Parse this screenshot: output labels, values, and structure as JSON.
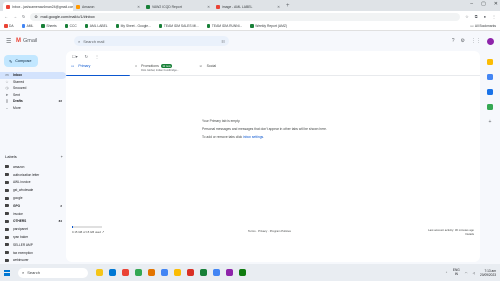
{
  "browser": {
    "tabs": [
      {
        "title": "Inbox - jashcameraw4man24@gmail.com",
        "color": "#ea4335",
        "active": true
      },
      {
        "title": "Amazon",
        "color": "#ff9900",
        "active": false
      },
      {
        "title": "VAW2 ICQD Report",
        "color": "#188038",
        "active": false
      },
      {
        "title": "image - AML LABEL",
        "color": "#ea4335",
        "active": false
      }
    ],
    "url": "mail.google.com/mail/u/1/#inbox",
    "bookmarks": [
      {
        "label": "DA",
        "color": "#ea4335"
      },
      {
        "label": "AML",
        "color": "#4285f4"
      },
      {
        "label": "Sheets",
        "color": "#188038"
      },
      {
        "label": "CCC",
        "color": "#188038"
      },
      {
        "label": "AML LABEL",
        "color": "#188038"
      },
      {
        "label": "My Sheet - Google...",
        "color": "#188038"
      },
      {
        "label": "TEAM IDM SALES MI...",
        "color": "#188038"
      },
      {
        "label": "TEAM IDM-RUNNI...",
        "color": "#188038"
      },
      {
        "label": "Weekly Report (AMZ)",
        "color": "#188038"
      }
    ],
    "all_bookmarks": "All Bookmarks"
  },
  "gmail": {
    "brand": "Gmail",
    "search_placeholder": "Search mail",
    "compose": "Compose",
    "nav": [
      {
        "label": "Inbox",
        "icon": "inbox-icon",
        "glyph": "▭",
        "count": "",
        "active": true
      },
      {
        "label": "Starred",
        "icon": "star-icon",
        "glyph": "☆",
        "count": ""
      },
      {
        "label": "Snoozed",
        "icon": "clock-icon",
        "glyph": "◷",
        "count": ""
      },
      {
        "label": "Sent",
        "icon": "send-icon",
        "glyph": "➤",
        "count": ""
      },
      {
        "label": "Drafts",
        "icon": "draft-icon",
        "glyph": "▯",
        "count": "22",
        "bold": true
      },
      {
        "label": "More",
        "icon": "chevron-down-icon",
        "glyph": "⌄",
        "count": ""
      }
    ],
    "labels_title": "Labels",
    "labels": [
      {
        "label": "amazon",
        "count": ""
      },
      {
        "label": "authorization letter",
        "count": ""
      },
      {
        "label": "AWL invoice",
        "count": ""
      },
      {
        "label": "gst_wholesale",
        "count": ""
      },
      {
        "label": "google",
        "count": ""
      },
      {
        "label": "GPO",
        "count": "2",
        "bold": true
      },
      {
        "label": "invoice",
        "count": ""
      },
      {
        "label": "OTHERS",
        "count": "84",
        "bold": true
      },
      {
        "label": "parcipanet",
        "count": ""
      },
      {
        "label": "ryan baker",
        "count": ""
      },
      {
        "label": "SELLER AMP",
        "count": ""
      },
      {
        "label": "tax exemption",
        "count": ""
      },
      {
        "label": "webinsurer",
        "count": ""
      },
      {
        "label": "WESTERN",
        "count": ""
      }
    ],
    "category_tabs": [
      {
        "label": "Primary",
        "icon": "inbox-icon",
        "badge": "",
        "sub": "",
        "active": true
      },
      {
        "label": "Promotions",
        "icon": "tag-icon",
        "badge": "10 new",
        "sub": "DHL Global, Indian Foodbridge..."
      },
      {
        "label": "Social",
        "icon": "people-icon",
        "badge": "",
        "sub": ""
      }
    ],
    "empty_title": "Your Primary tab is empty.",
    "empty_body": "Personal messages and messages that don't appear in other tabs will be shown here.",
    "empty_settings_prefix": "To add or remove tabs click ",
    "empty_settings_link": "inbox settings",
    "storage_text": "0.15 GB of 15 GB used",
    "storage_fraction": 0.01,
    "footer_links": "Terms · Privacy · Program Policies",
    "last_activity": "Last account activity: 30 minutes ago",
    "details": "Details"
  },
  "taskbar": {
    "search_placeholder": "Search",
    "apps": [
      "#f5c518",
      "#0078d4",
      "#ea4335",
      "#34a853",
      "#e37400",
      "#4285f4",
      "#fbbc04",
      "#d93025",
      "#188038",
      "#4285f4",
      "#8e24aa",
      "#107c10"
    ],
    "lang_top": "ENG",
    "lang_bottom": "IN",
    "time": "7:13 am",
    "date": "20/09/2023"
  }
}
